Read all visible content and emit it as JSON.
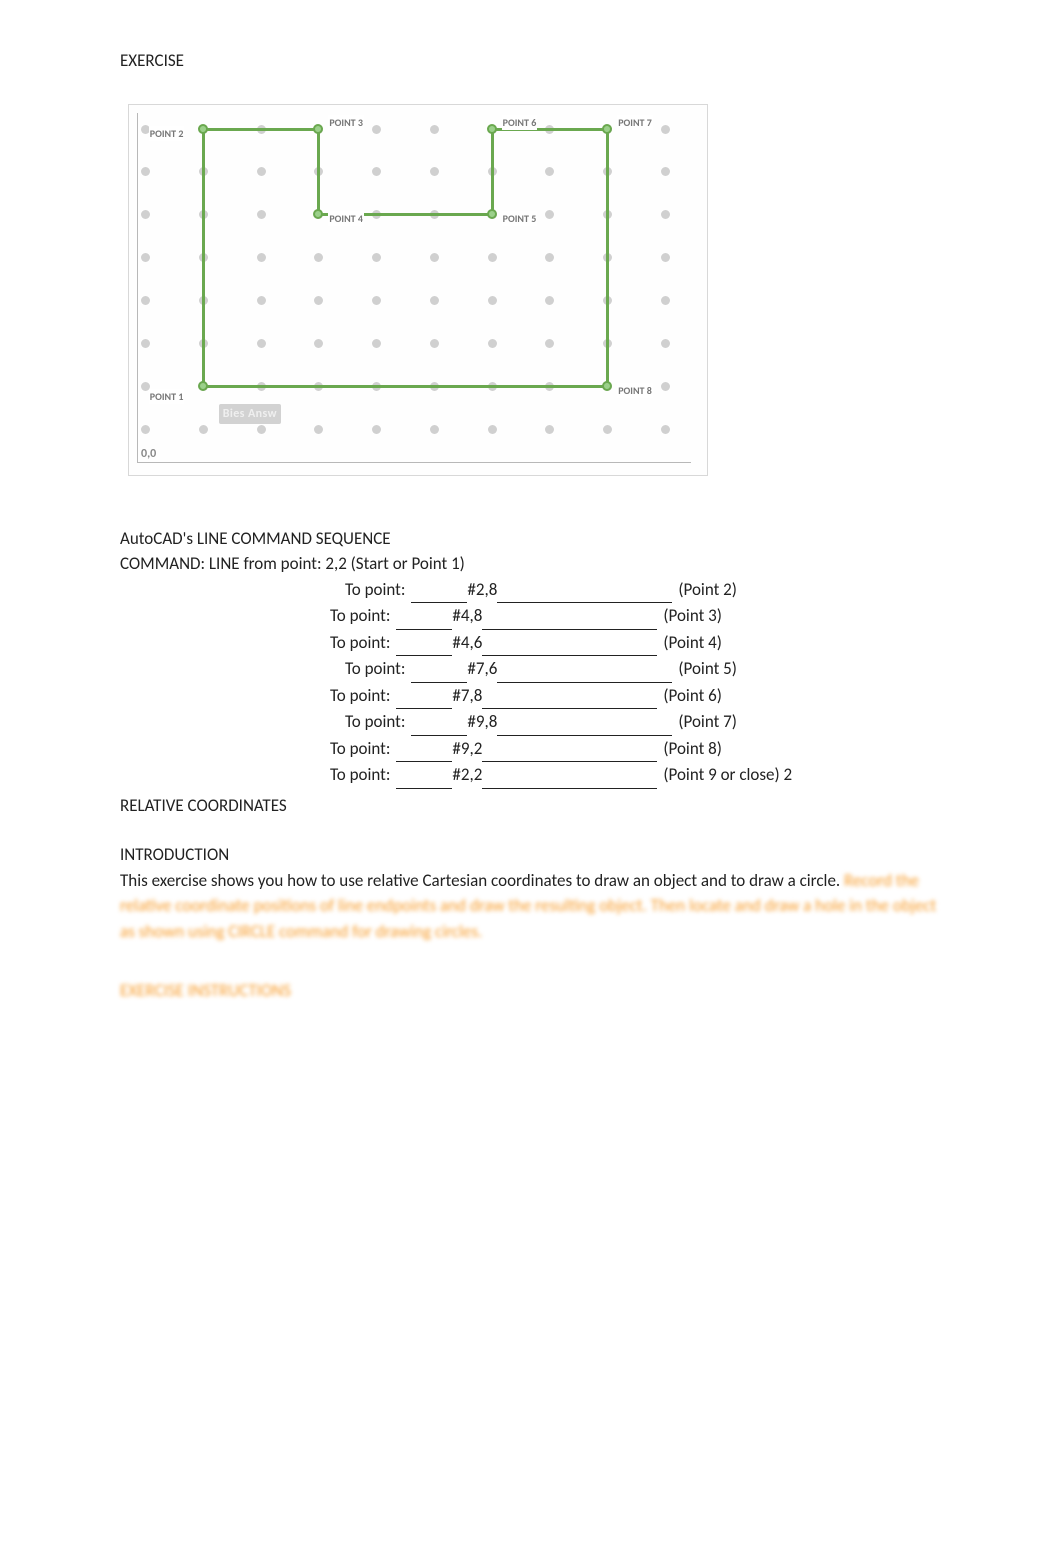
{
  "top_title": "EXERCISE",
  "diagram": {
    "dot_rows": 8,
    "dot_cols": 10,
    "points": [
      {
        "name": "POINT 1",
        "x": 2,
        "y": 2
      },
      {
        "name": "POINT 2",
        "x": 2,
        "y": 8
      },
      {
        "name": "POINT 3",
        "x": 4,
        "y": 8
      },
      {
        "name": "POINT 4",
        "x": 4,
        "y": 6
      },
      {
        "name": "POINT 5",
        "x": 7,
        "y": 6
      },
      {
        "name": "POINT 6",
        "x": 7,
        "y": 8
      },
      {
        "name": "POINT 7",
        "x": 9,
        "y": 8
      },
      {
        "name": "POINT 8",
        "x": 9,
        "y": 2
      }
    ],
    "origin_label": "0,0",
    "watermark": "Bies Answ"
  },
  "seq_title": "AutoCAD's LINE COMMAND SEQUENCE",
  "seq_cmd": "COMMAND:  LINE from point: 2,2  (Start or Point 1)",
  "rows": [
    {
      "label": "To point:",
      "ul1": "",
      "val": "#2,8",
      "ul2": "",
      "note": "(Point 2)",
      "indent": 225
    },
    {
      "label": "To point:",
      "ul1": "",
      "val": "#4,8",
      "ul2": "",
      "note": "(Point 3)",
      "indent": 210
    },
    {
      "label": "To point:",
      "ul1": "",
      "val": "#4,6",
      "ul2": "",
      "note": "(Point 4)",
      "indent": 210
    },
    {
      "label": "To point:",
      "ul1": "",
      "val": "#7,6",
      "ul2": "",
      "note": "(Point 5)",
      "indent": 225
    },
    {
      "label": "To point:",
      "ul1": "",
      "val": "#7,8",
      "ul2": "",
      "note": "(Point 6)",
      "indent": 210
    },
    {
      "label": "To point:",
      "ul1": "",
      "val": "#9,8",
      "ul2": "",
      "note": "(Point 7)",
      "indent": 225
    },
    {
      "label": "To point:",
      "ul1": "",
      "val": "#9,2",
      "ul2": "",
      "note": "(Point 8)",
      "indent": 210
    },
    {
      "label": "To point:",
      "ul1": "",
      "val": "#2,2",
      "ul2": "",
      "note": "(Point 9 or close) 2",
      "indent": 210
    }
  ],
  "rel_title": "RELATIVE COORDINATES",
  "intro_title": "INTRODUCTION",
  "intro_body": "This exercise shows you how to use relative Cartesian coordinates to draw an object and to draw a circle.  ",
  "intro_blur1": "Record the relative coordinate positions of line endpoints and draw the resulting object. Then locate and draw a hole in the object as shown using CIRCLE command for drawing circles.",
  "blur_heading": "EXERCISE INSTRUCTIONS"
}
